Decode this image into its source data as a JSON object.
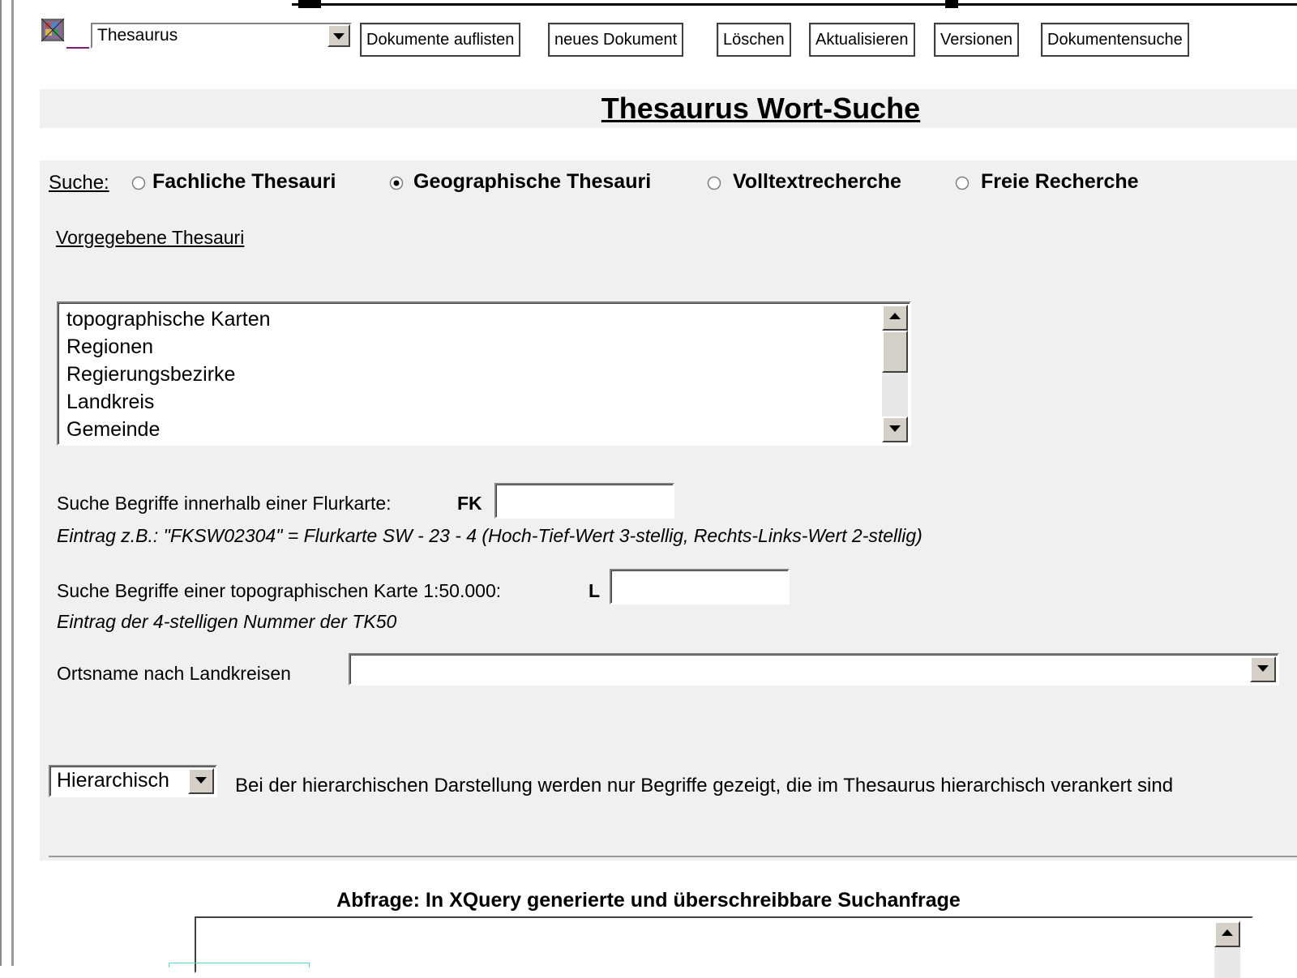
{
  "toolbar": {
    "module_select": "Thesaurus",
    "buttons": [
      "Dokumente auflisten",
      "neues Dokument",
      "Löschen",
      "Aktualisieren",
      "Versionen",
      "Dokumentensuche"
    ]
  },
  "page_title": "Thesaurus Wort-Suche",
  "search": {
    "label": "Suche:",
    "options": [
      {
        "label": "Fachliche Thesauri",
        "selected": false
      },
      {
        "label": "Geographische Thesauri",
        "selected": true
      },
      {
        "label": "Volltextrecherche",
        "selected": false
      },
      {
        "label": "Freie Recherche",
        "selected": false
      }
    ]
  },
  "thesauri": {
    "link": "Vorgegebene Thesauri",
    "items": [
      "topographische Karten",
      "Regionen",
      "Regierungsbezirke",
      "Landkreis",
      "Gemeinde"
    ]
  },
  "flurkarte": {
    "label": "Suche Begriffe innerhalb einer Flurkarte:",
    "prefix": "FK",
    "value": "",
    "hint": "Eintrag z.B.: \"FKSW02304\" = Flurkarte SW - 23 - 4 (Hoch-Tief-Wert 3-stellig, Rechts-Links-Wert 2-stellig)"
  },
  "topokarte": {
    "label": "Suche Begriffe einer topographischen Karte 1:50.000:",
    "prefix": "L",
    "value": "",
    "hint": "Eintrag der 4-stelligen Nummer der TK50"
  },
  "ortsname": {
    "label": "Ortsname nach Landkreisen",
    "value": ""
  },
  "display": {
    "mode": "Hierarchisch",
    "note": "Bei der hierarchischen Darstellung werden nur Begriffe gezeigt, die im Thesaurus hierarchisch verankert sind"
  },
  "query": {
    "label": "Abfrage: In XQuery generierte und überschreibbare Suchanfrage",
    "value": ""
  }
}
